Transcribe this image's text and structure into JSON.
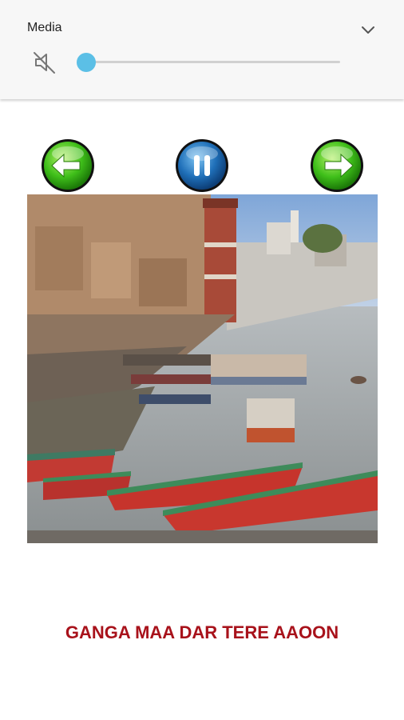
{
  "media_panel": {
    "title": "Media",
    "volume_level": 0.0,
    "expand_icon": "chevron-down-icon",
    "mute_icon": "volume-muted-icon",
    "slider_color": "#5bbfe6"
  },
  "player": {
    "prev_icon": "arrow-left-icon",
    "pause_icon": "pause-icon",
    "next_icon": "arrow-right-icon",
    "prev_color": "#3fbf1a",
    "pause_color": "#1f6fb8",
    "next_color": "#3fbf1a",
    "image": "varanasi-ghats-boats-photo",
    "song_title": "GANGA MAA DAR TERE AAOON",
    "title_color": "#a8121b"
  }
}
